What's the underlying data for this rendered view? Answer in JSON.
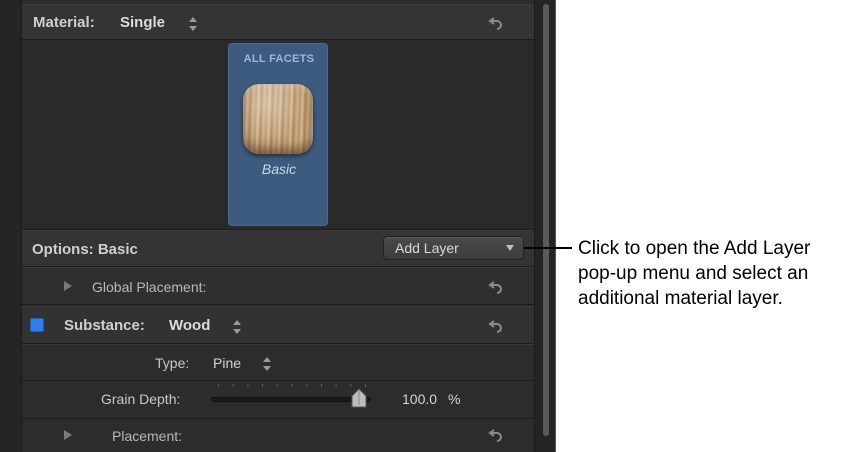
{
  "material": {
    "label": "Material:",
    "value": "Single"
  },
  "facet": {
    "title": "ALL FACETS",
    "name": "Basic"
  },
  "options": {
    "label": "Options: Basic",
    "add_layer_label": "Add Layer"
  },
  "global_placement": {
    "label": "Global Placement:"
  },
  "substance": {
    "label": "Substance:",
    "value": "Wood",
    "enabled": true,
    "color": "#2d7ff0"
  },
  "type": {
    "label": "Type:",
    "value": "Pine"
  },
  "grain_depth": {
    "label": "Grain Depth:",
    "value": "100.0",
    "unit": "%",
    "level": 1.0
  },
  "placement": {
    "label": "Placement:"
  },
  "callout": {
    "text": "Click to open the Add Layer\npop-up menu and select an\nadditional material layer."
  },
  "colors": {
    "panel": "#2c2c2c",
    "facet_card": "#3d5a7f",
    "accent_blue": "#2d7ff0"
  }
}
